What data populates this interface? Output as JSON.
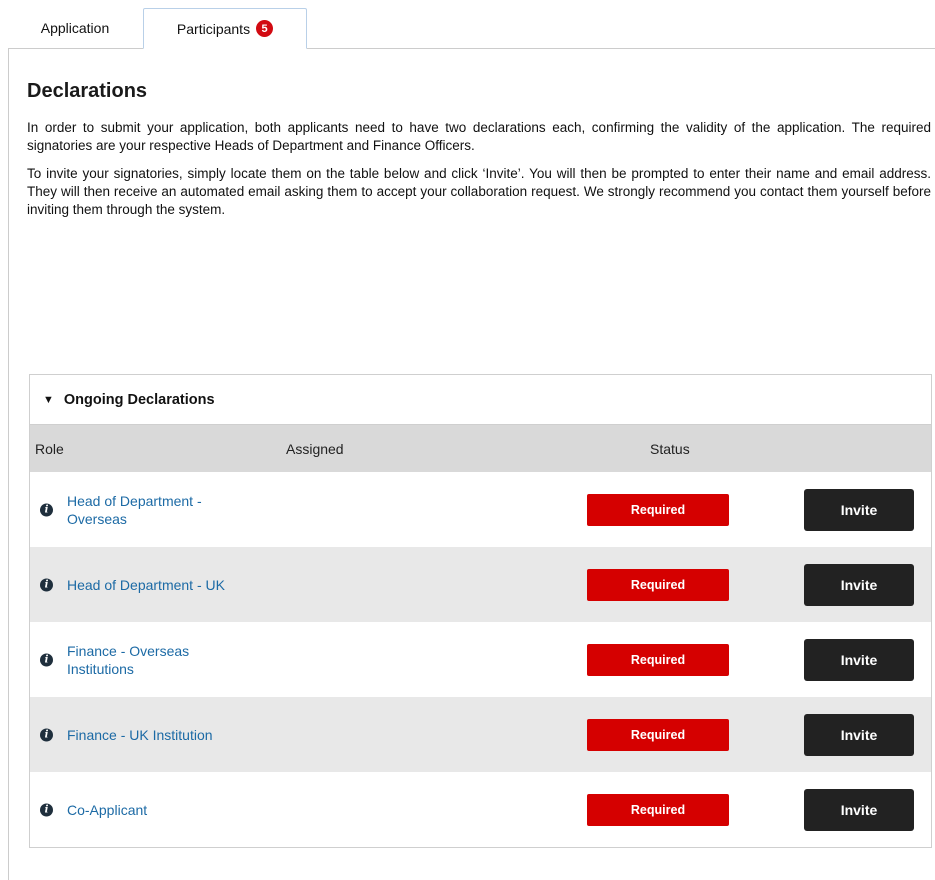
{
  "tabs": {
    "application": "Application",
    "participants": "Participants",
    "participants_badge": "5"
  },
  "declarations": {
    "title": "Declarations",
    "paragraph1": "In order to submit your application, both applicants need to have two declarations each, confirming the validity of the application. The required signatories are your respective Heads of Department and Finance Officers.",
    "paragraph2": "To invite your signatories, simply locate them on the table below and click ‘Invite’. You will then be prompted to enter their name and email address. They will then receive an automated email asking them to accept your collaboration request. We strongly recommend you contact them yourself before inviting them through the system."
  },
  "ongoing": {
    "title": "Ongoing Declarations",
    "columns": {
      "role": "Role",
      "assigned": "Assigned",
      "status": "Status"
    },
    "rows": [
      {
        "role": "Head of Department - Overseas",
        "assigned": "",
        "status": "Required",
        "action": "Invite"
      },
      {
        "role": "Head of Department - UK",
        "assigned": "",
        "status": "Required",
        "action": "Invite"
      },
      {
        "role": "Finance - Overseas Institutions",
        "assigned": "",
        "status": "Required",
        "action": "Invite"
      },
      {
        "role": "Finance - UK Institution",
        "assigned": "",
        "status": "Required",
        "action": "Invite"
      },
      {
        "role": "Co-Applicant",
        "assigned": "",
        "status": "Required",
        "action": "Invite"
      }
    ]
  },
  "colors": {
    "badge": "#d20a11",
    "status_required": "#d50000",
    "invite_button": "#222222",
    "link": "#1c6aa5"
  },
  "icons": {
    "info": "info-icon",
    "caret": "caret-down-icon"
  }
}
